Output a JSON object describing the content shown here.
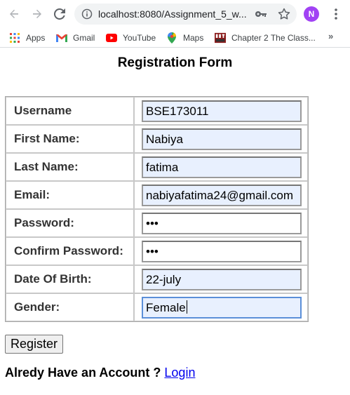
{
  "browser": {
    "url": "localhost:8080/Assignment_5_w...",
    "profile_initial": "N",
    "bookmarks": [
      {
        "label": "Apps",
        "icon": "apps-grid-icon"
      },
      {
        "label": "Gmail",
        "icon": "gmail-icon"
      },
      {
        "label": "YouTube",
        "icon": "youtube-icon"
      },
      {
        "label": "Maps",
        "icon": "maps-icon"
      },
      {
        "label": "Chapter 2 The Class...",
        "icon": "mit-ocw-icon"
      }
    ],
    "more_label": "»"
  },
  "form": {
    "title": "Registration Form",
    "rows": [
      {
        "label": "Username",
        "value": "BSE173011"
      },
      {
        "label": "First Name:",
        "value": "Nabiya"
      },
      {
        "label": "Last Name:",
        "value": "fatima"
      },
      {
        "label": "Email:",
        "value": "nabiyafatima24@gmail.com"
      },
      {
        "label": "Password:",
        "value": "•••"
      },
      {
        "label": "Confirm Password:",
        "value": "•••"
      },
      {
        "label": "Date Of Birth:",
        "value": "22-july"
      },
      {
        "label": "Gender:",
        "value": "Female"
      }
    ],
    "register_label": "Register",
    "account_text": "Alredy Have an Account ?",
    "login_label": "Login"
  },
  "colors": {
    "autofill_bg": "#e8f0fe",
    "link": "#0000ee",
    "profile": "#a142f4"
  }
}
